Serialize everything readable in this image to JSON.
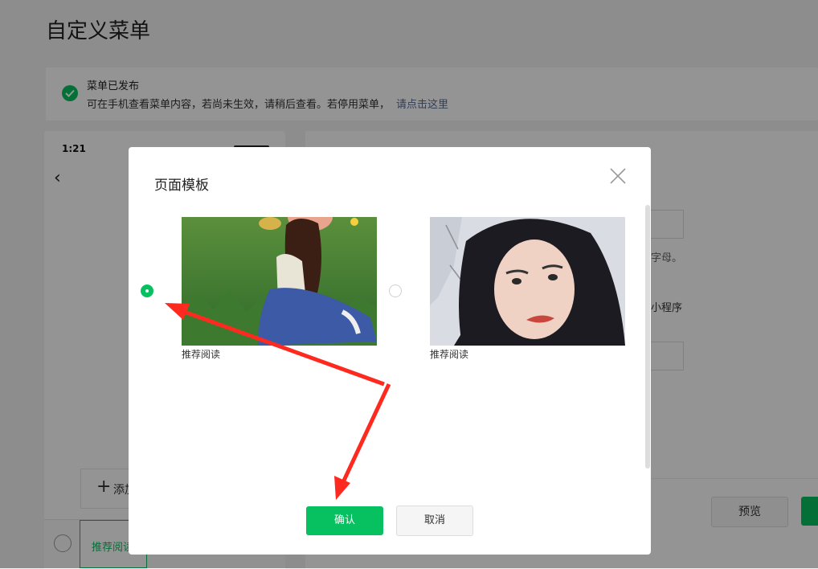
{
  "page": {
    "title": "自定义菜单"
  },
  "notice": {
    "title": "菜单已发布",
    "message": "可在手机查看菜单内容，若尚未生效，请稍后查看。若停用菜单，",
    "link": "请点击这里"
  },
  "phone": {
    "time": "1:21",
    "add_label": "添加",
    "menu_item": "推荐阅读"
  },
  "editor": {
    "hint_letters": "字母。",
    "hint_miniprogram": "小程序",
    "preview_label": "预览"
  },
  "modal": {
    "title": "页面模板",
    "options": [
      {
        "caption": "推荐阅读",
        "selected": true
      },
      {
        "caption": "推荐阅读",
        "selected": false
      }
    ],
    "confirm_label": "确认",
    "cancel_label": "取消"
  },
  "colors": {
    "accent": "#07c160",
    "link": "#576b95",
    "arrow": "#ff2a1f"
  }
}
